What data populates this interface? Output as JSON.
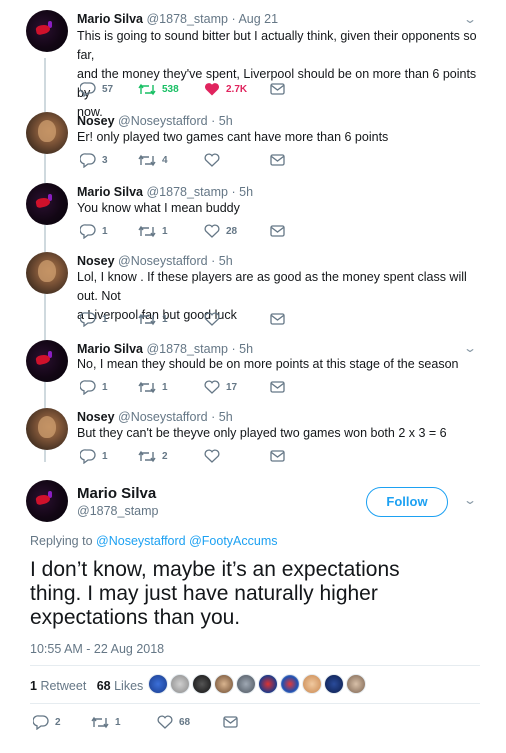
{
  "colors": {
    "accent": "#1da1f2",
    "retweet": "#17bf63",
    "like": "#e0245e",
    "muted": "#657786"
  },
  "tweets": [
    {
      "name": "Mario Silva",
      "handle": "@1878_stamp",
      "time": "Aug 21",
      "lines": [
        "This is going to sound bitter but I actually think, given their opponents so far,",
        "and the money they've spent, Liverpool should be on more than 6 points by",
        "now."
      ],
      "replies": "57",
      "retweets": "538",
      "likes": "2.7K"
    },
    {
      "name": "Nosey",
      "handle": "@Noseystafford",
      "time": "5h",
      "lines": [
        "Er! only played two games cant have more than 6 points"
      ],
      "replies": "3",
      "retweets": "4",
      "likes": ""
    },
    {
      "name": "Mario Silva",
      "handle": "@1878_stamp",
      "time": "5h",
      "lines": [
        "You know what I mean buddy"
      ],
      "replies": "1",
      "retweets": "1",
      "likes": "28"
    },
    {
      "name": "Nosey",
      "handle": "@Noseystafford",
      "time": "5h",
      "lines": [
        "Lol, I know . If these players are as good as the money spent class will out. Not",
        "a Liverpool fan but good luck"
      ],
      "replies": "1",
      "retweets": "1",
      "likes": ""
    },
    {
      "name": "Mario Silva",
      "handle": "@1878_stamp",
      "time": "5h",
      "lines": [
        "No, I mean they should be on more points at this stage of the season"
      ],
      "replies": "1",
      "retweets": "1",
      "likes": "17"
    },
    {
      "name": "Nosey",
      "handle": "@Noseystafford",
      "time": "5h",
      "lines": [
        "But they can't be theyve only played two games won both 2 x 3 = 6"
      ],
      "replies": "1",
      "retweets": "2",
      "likes": ""
    }
  ],
  "main_tweet": {
    "name": "Mario Silva",
    "handle": "@1878_stamp",
    "follow_label": "Follow",
    "replying_prefix": "Replying to",
    "replying_to": [
      "@Noseystafford",
      "@FootyAccums"
    ],
    "lines": [
      "I don’t know, maybe it’s an expectations",
      "thing. I may just have naturally higher",
      "expectations than you."
    ],
    "timestamp": "10:55 AM - 22 Aug 2018",
    "retweet_count": "1",
    "retweet_label": "Retweet",
    "like_count": "68",
    "like_label": "Likes",
    "replies": "2",
    "retweets": "1",
    "likes": "68"
  }
}
